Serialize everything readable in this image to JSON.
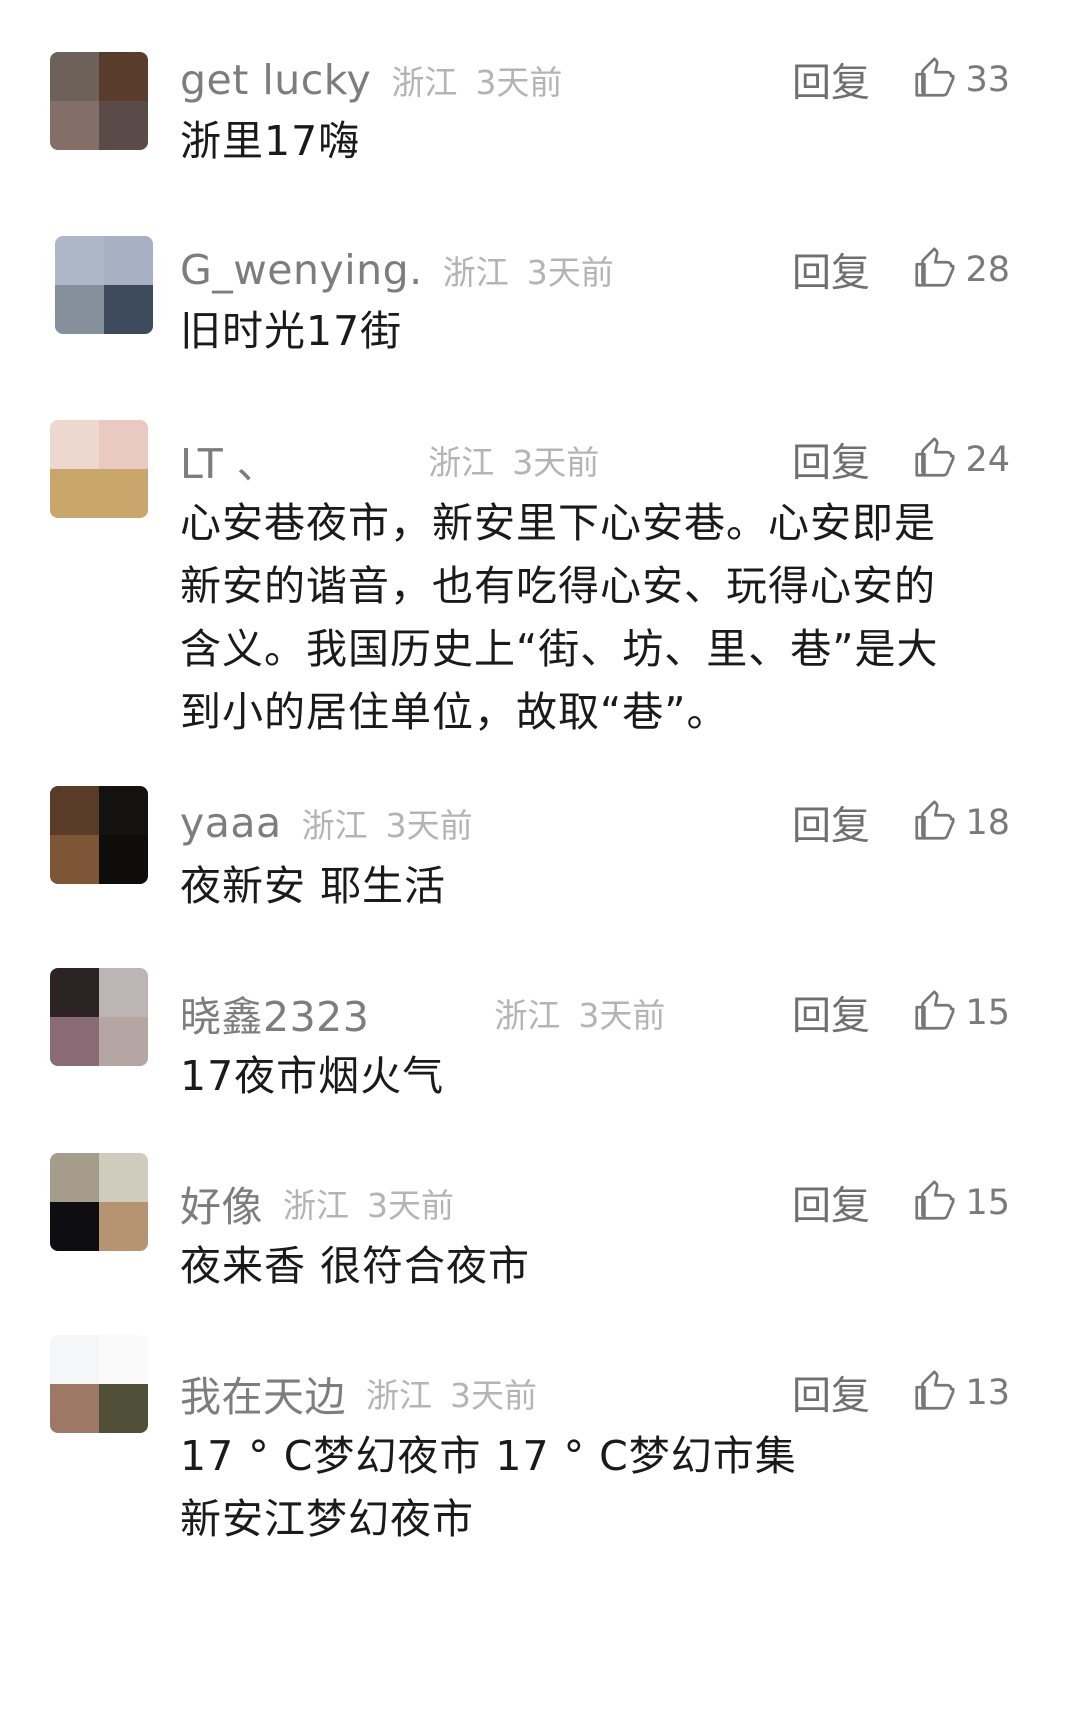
{
  "reply_label": "回复",
  "comments": [
    {
      "username": "get lucky",
      "location": "浙江",
      "time": "3天前",
      "likes": "33",
      "text": [
        "浙里17嗨"
      ],
      "avatar_colors": [
        "#6e615a",
        "#5a3c2c",
        "#836f68",
        "#5b4b48"
      ]
    },
    {
      "username": "G_wenying.",
      "location": "浙江",
      "time": "3天前",
      "likes": "28",
      "text": [
        "旧时光17街"
      ],
      "avatar_colors": [
        "#aeb7c8",
        "#a7b1c3",
        "#868f9c",
        "#3c4a5c"
      ]
    },
    {
      "username": "LT 、",
      "location": "浙江",
      "time": "3天前",
      "likes": "24",
      "text": [
        "心安巷夜市，新安里下心安巷。心安即是",
        "新安的谐音，也有吃得心安、玩得心安的",
        "含义。我国历史上“街、坊、里、巷”是大",
        "到小的居住单位，故取“巷”。"
      ],
      "avatar_colors": [
        "#ecd8cf",
        "#e9c9c1",
        "#c9a66c",
        "#c9a66c"
      ]
    },
    {
      "username": "yaaa",
      "location": "浙江",
      "time": "3天前",
      "likes": "18",
      "text": [
        "夜新安 耶生活"
      ],
      "avatar_colors": [
        "#5a3a28",
        "#141210",
        "#7c5637",
        "#0f0d0c"
      ]
    },
    {
      "username": "晓鑫2323",
      "location": "浙江",
      "time": "3天前",
      "likes": "15",
      "text": [
        "17夜市烟火气"
      ],
      "avatar_colors": [
        "#2c2424",
        "#bdb5b5",
        "#8a6a74",
        "#b5a6a4"
      ]
    },
    {
      "username": "好像",
      "location": "浙江",
      "time": "3天前",
      "likes": "15",
      "text": [
        "夜来香 很符合夜市"
      ],
      "avatar_colors": [
        "#a59c8b",
        "#cfcbbd",
        "#0d0d12",
        "#b69471"
      ]
    },
    {
      "username": "我在天边",
      "location": "浙江",
      "time": "3天前",
      "likes": "13",
      "text": [
        "17 ° C梦幻夜市     17 ° C梦幻市集",
        "新安江梦幻夜市"
      ],
      "avatar_colors": [
        "#f4f6f8",
        "#fafafa",
        "#9c7865",
        "#505039"
      ]
    }
  ]
}
